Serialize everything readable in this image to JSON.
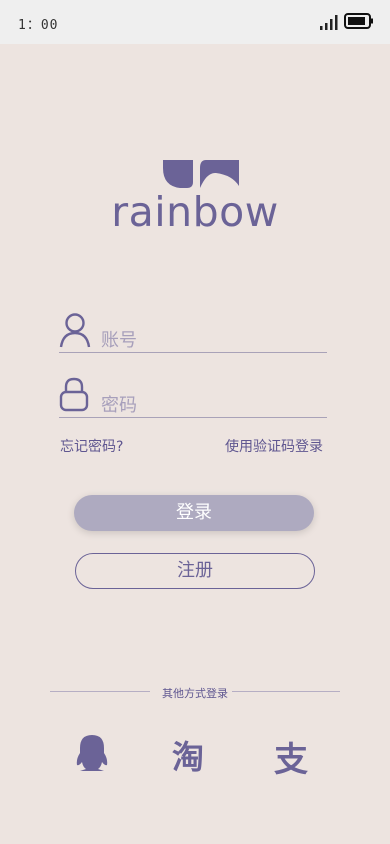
{
  "status_bar": {
    "time": "1：00"
  },
  "brand": {
    "name": "rainbow"
  },
  "login_form": {
    "account_placeholder": "账号",
    "password_placeholder": "密码",
    "forgot_password": "忘记密码?",
    "sms_login": "使用验证码登录",
    "login_button": "登录",
    "register_button": "注册"
  },
  "other_login": {
    "label": "其他方式登录",
    "taobao_glyph": "淘",
    "alipay_glyph": "支",
    "icons": [
      "qq-icon",
      "taobao-icon",
      "alipay-icon"
    ]
  },
  "colors": {
    "accent": "#6b6397",
    "background": "#ede4e0",
    "button": "#aeaac0"
  }
}
